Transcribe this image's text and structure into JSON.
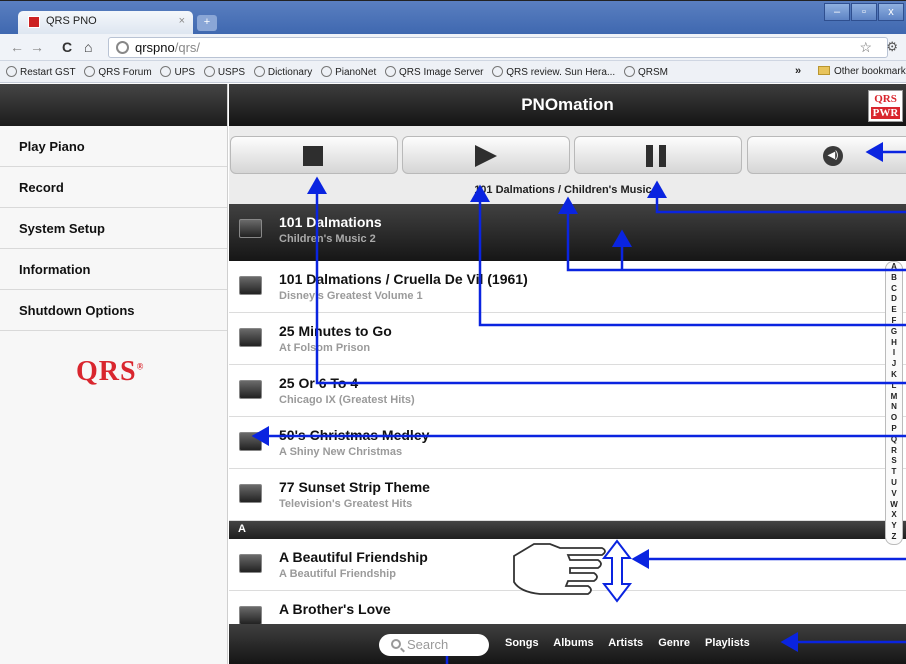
{
  "browser": {
    "tab_title": "QRS PNO",
    "tab_close": "×",
    "new_tab": "+",
    "window_buttons": [
      "–",
      "▫",
      "x"
    ],
    "url_host": "qrspno",
    "url_path": "/qrs/",
    "bookmarks": [
      "Restart GST",
      "QRS Forum",
      "UPS",
      "USPS",
      "Dictionary",
      "PianoNet",
      "QRS Image Server",
      "QRS review. Sun Hera...",
      "QRSM"
    ],
    "bookmarks_more": "»",
    "other_bookmarks": "Other bookmark"
  },
  "app": {
    "title": "PNOmation",
    "logo_top": "QRS",
    "logo_bottom": "PWR",
    "brand": "QRS"
  },
  "sidebar": {
    "items": [
      {
        "label": "Play Piano"
      },
      {
        "label": "Record"
      },
      {
        "label": "System Setup"
      },
      {
        "label": "Information"
      },
      {
        "label": "Shutdown Options"
      }
    ]
  },
  "player": {
    "now_playing": "101 Dalmations / Children's Music 2"
  },
  "songs": [
    {
      "title": "101 Dalmations",
      "subtitle": "Children's Music 2"
    },
    {
      "title": "101 Dalmations / Cruella De Vil (1961)",
      "subtitle": "Disney's Greatest Volume 1"
    },
    {
      "title": "25 Minutes to Go",
      "subtitle": "At Folsom Prison"
    },
    {
      "title": "25 Or 6 To 4",
      "subtitle": "Chicago IX (Greatest Hits)"
    },
    {
      "title": "50's Christmas Medley",
      "subtitle": "A Shiny New Christmas"
    },
    {
      "title": "77 Sunset Strip Theme",
      "subtitle": "Television's Greatest Hits"
    }
  ],
  "section_a": "A",
  "songs_a": [
    {
      "title": "A Beautiful Friendship",
      "subtitle": "A Beautiful Friendship"
    },
    {
      "title": "A Brother's Love",
      "subtitle": ""
    }
  ],
  "alphabet": [
    "A",
    "B",
    "C",
    "D",
    "E",
    "F",
    "G",
    "H",
    "I",
    "J",
    "K",
    "L",
    "M",
    "N",
    "O",
    "P",
    "Q",
    "R",
    "S",
    "T",
    "U",
    "V",
    "W",
    "X",
    "Y",
    "Z"
  ],
  "bottom": {
    "search_placeholder": "Search",
    "nav": [
      "Songs",
      "Albums",
      "Artists",
      "Genre",
      "Playlists"
    ]
  },
  "annotation_color": "#0a24e0"
}
